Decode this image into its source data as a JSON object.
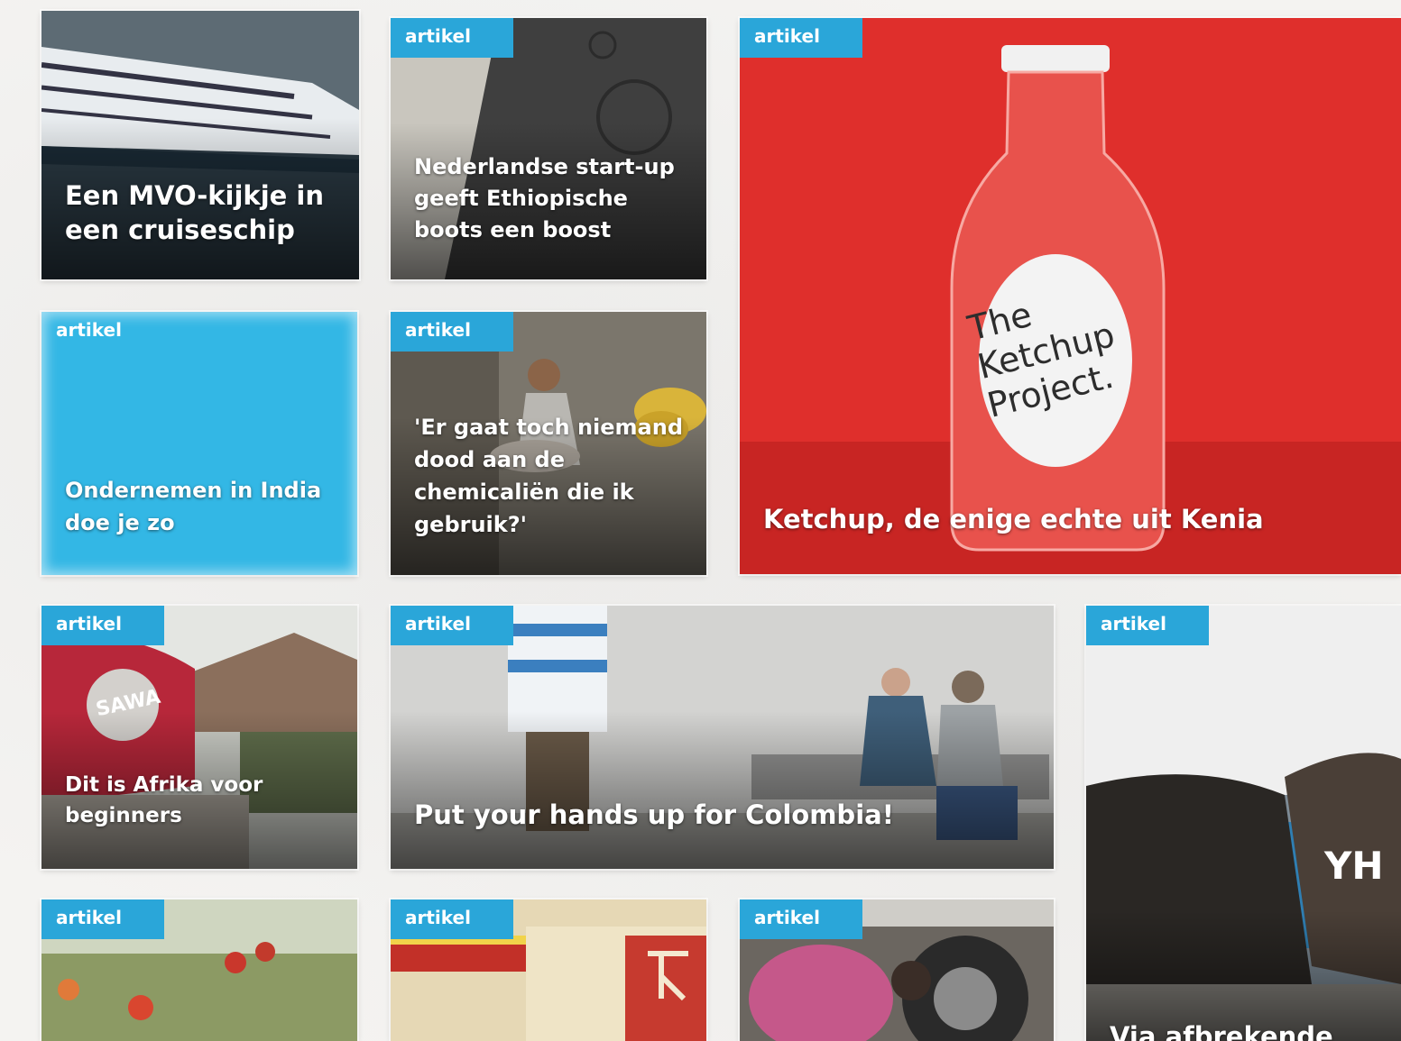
{
  "tiles": [
    {
      "badge": "",
      "title": "Een MVO-kijkje in een cruiseschip"
    },
    {
      "badge": "artikel",
      "title": "Nederlandse start-up geeft Ethiopische boots een boost"
    },
    {
      "badge": "artikel",
      "title": "Ketchup, de enige echte uit Kenia",
      "bottle_label": [
        "The",
        "Ketchup",
        "Project."
      ]
    },
    {
      "badge": "artikel",
      "title": "Ondernemen in India doe je zo"
    },
    {
      "badge": "artikel",
      "title": "'Er gaat toch niemand dood aan de chemicaliën die ik gebruik?'"
    },
    {
      "badge": "artikel",
      "title": "Dit is Afrika voor beginners",
      "photo_text": "SAWA"
    },
    {
      "badge": "artikel",
      "title": "Put your hands up for Colombia!"
    },
    {
      "badge": "artikel",
      "title": "Via afbrekende",
      "photo_text": "YH"
    },
    {
      "badge": "artikel",
      "title": ""
    },
    {
      "badge": "artikel",
      "title": ""
    },
    {
      "badge": "artikel",
      "title": ""
    }
  ],
  "colors": {
    "badge_blue": "#2aa6d9",
    "tile_blue": "#33b7e5",
    "ketchup_red": "#e0322f",
    "background": "#f4f3f1"
  }
}
